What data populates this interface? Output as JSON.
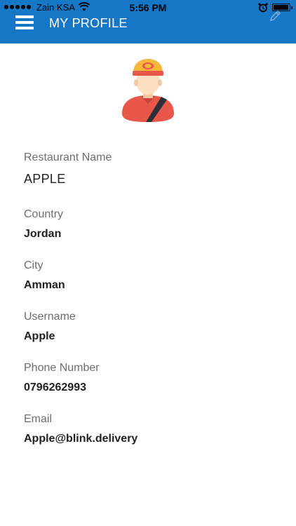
{
  "status_bar": {
    "carrier": "Zain KSA",
    "time": "5:56 PM"
  },
  "header": {
    "title": "MY PROFILE",
    "menu_icon": "hamburger-menu-icon",
    "edit_icon": "edit-pencil-icon",
    "color": "#1677c7"
  },
  "avatar": {
    "icon": "delivery-person-avatar"
  },
  "profile": {
    "restaurant_name": {
      "label": "Restaurant Name",
      "value": "APPLE"
    },
    "country": {
      "label": "Country",
      "value": "Jordan"
    },
    "city": {
      "label": "City",
      "value": "Amman"
    },
    "username": {
      "label": "Username",
      "value": "Apple"
    },
    "phone": {
      "label": "Phone Number",
      "value": "0796262993"
    },
    "email": {
      "label": "Email",
      "value": "Apple@blink.delivery"
    }
  }
}
